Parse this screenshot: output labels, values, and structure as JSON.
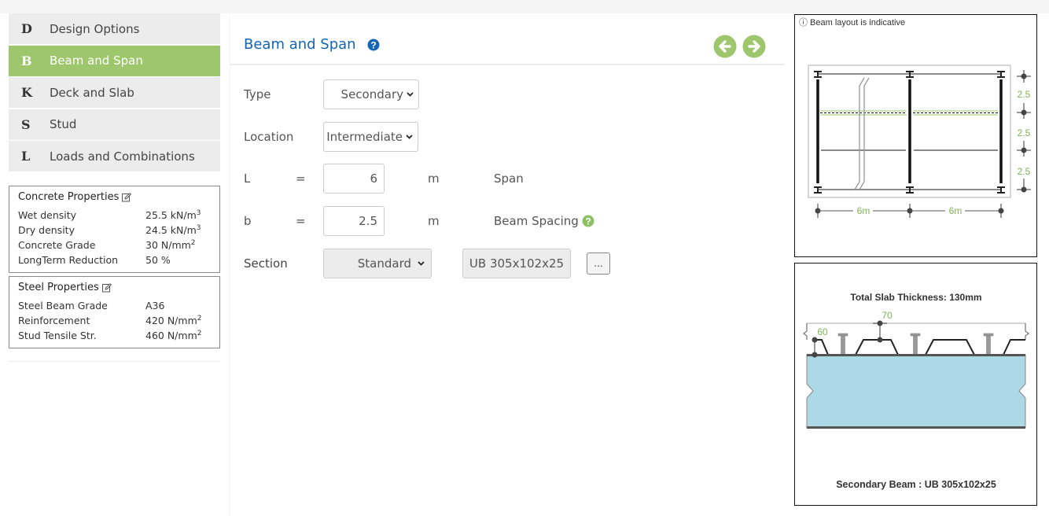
{
  "colors": {
    "accent_green": "#9dc66d",
    "title_blue": "#1565b3",
    "dimension_green": "#7fb25a",
    "slab_blue": "#add8e6"
  },
  "sidebar": {
    "items": [
      {
        "letter": "D",
        "label": "Design Options",
        "active": false
      },
      {
        "letter": "B",
        "label": "Beam and Span",
        "active": true
      },
      {
        "letter": "K",
        "label": "Deck and Slab",
        "active": false
      },
      {
        "letter": "S",
        "label": "Stud",
        "active": false
      },
      {
        "letter": "L",
        "label": "Loads and Combinations",
        "active": false
      }
    ],
    "concrete": {
      "title": "Concrete Properties",
      "icon": "edit-icon",
      "rows": [
        {
          "key": "Wet density",
          "value": "25.5 kN/m",
          "sup": "3"
        },
        {
          "key": "Dry density",
          "value": "24.5 kN/m",
          "sup": "3"
        },
        {
          "key": "Concrete Grade",
          "value": "30 N/mm",
          "sup": "2"
        },
        {
          "key": "LongTerm Reduction",
          "value": "50 %",
          "sup": ""
        }
      ]
    },
    "steel": {
      "title": "Steel Properties",
      "icon": "edit-icon",
      "rows": [
        {
          "key": "Steel Beam Grade",
          "value": "A36",
          "sup": ""
        },
        {
          "key": "Reinforcement",
          "value": "420 N/mm",
          "sup": "2"
        },
        {
          "key": "Stud Tensile Str.",
          "value": "460 N/mm",
          "sup": "2"
        }
      ]
    }
  },
  "main": {
    "title": "Beam and Span",
    "help_icon": "question-circle-icon",
    "nav": {
      "prev_icon": "arrow-left-circle-icon",
      "next_icon": "arrow-right-circle-icon"
    },
    "form": {
      "type": {
        "label": "Type",
        "value": "Secondary"
      },
      "location": {
        "label": "Location",
        "value": "Intermediate"
      },
      "span": {
        "symbol": "L",
        "eq": "=",
        "value": "6",
        "unit": "m",
        "desc": "Span"
      },
      "spacing": {
        "symbol": "b",
        "eq": "=",
        "value": "2.5",
        "unit": "m",
        "desc": "Beam Spacing"
      },
      "section": {
        "label": "Section",
        "type_value": "Standard",
        "designation": "UB 305x102x25",
        "browse_label": "..."
      }
    }
  },
  "layout_diagram": {
    "note": "ⓘ Beam layout is indicative",
    "spacing_labels": [
      "2.5",
      "2.5",
      "2.5"
    ],
    "span_labels": [
      "6m",
      "6m"
    ]
  },
  "section_diagram": {
    "title": "Total Slab Thickness: 130mm",
    "deck_height_label": "60",
    "topping_label": "70",
    "caption": "Secondary Beam : UB 305x102x25"
  }
}
